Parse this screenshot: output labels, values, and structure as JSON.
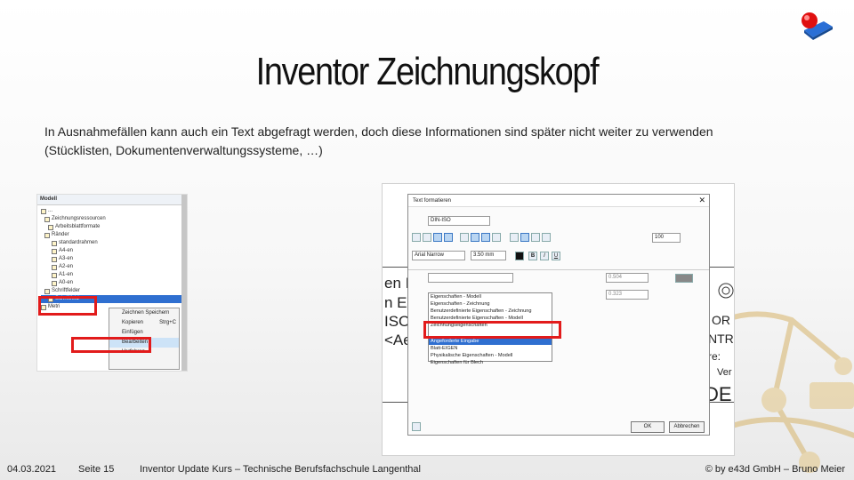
{
  "slide": {
    "title": "Inventor Zeichnungskopf",
    "intro": "In Ausnahmefällen kann auch ein Text abgefragt werden, doch diese Informationen sind später nicht weiter zu verwenden (Stücklisten, Dokumentenverwaltungssysteme, …)"
  },
  "tree": {
    "header": "Modell",
    "items": [
      "...",
      "Zeichnungsressourcen",
      "Arbeitsblattformate",
      "Ränder",
      "standardrahmen",
      "A4-en",
      "A3-en",
      "A2-en",
      "A1-en",
      "A0-en",
      "Schriftfelder",
      "Schriftfeld",
      "Metri"
    ],
    "context_menu": [
      "Zeichnen Speichern",
      "Kopieren",
      "Einfügen",
      "Bearbeiten",
      "Verfahren..."
    ],
    "shortcut": "Strg+C"
  },
  "dialog": {
    "title": "Text formatieren",
    "close": "✕",
    "style_select": "DIN-ISO",
    "font_select": "Arial Narrow",
    "size_select": "3.50 mm",
    "spacing_value": "100",
    "field_a": "0.504",
    "field_b": "0.323",
    "format_buttons": [
      "B",
      "I",
      "U"
    ],
    "type_options": [
      "Eigenschaften - Modell",
      "Eigenschaften - Zeichnung",
      "Benutzerdefinierte Eigenschaften - Zeichnung",
      "Benutzerdefinierte Eigenschaften - Modell",
      "Zeichnungseigenschaften",
      "Angeforderte Eingabe",
      "Blatt-EIGEN",
      "Physikalische Eigenschaften - Modell",
      "Eigenschaften für Blech"
    ],
    "selected_option": "Angeforderte Eingabe",
    "ok": "OK",
    "cancel": "Abbrechen"
  },
  "cad_labels": [
    "en IS",
    "n EN",
    "ISO",
    "<Aen"
  ],
  "cad_labels_right": [
    "OR",
    "NTR",
    "re:",
    "Ver",
    "DE"
  ],
  "footer": {
    "date": "04.03.2021",
    "page": "Seite 15",
    "course": "Inventor Update Kurs – Technische Berufsfachschule Langenthal",
    "copyright": "© by e43d GmbH – Bruno Meier"
  },
  "colors": {
    "highlight": "#e21b1b",
    "selection": "#2f6fd0",
    "logo_red": "#e01010",
    "logo_blue": "#2a6fd6"
  }
}
